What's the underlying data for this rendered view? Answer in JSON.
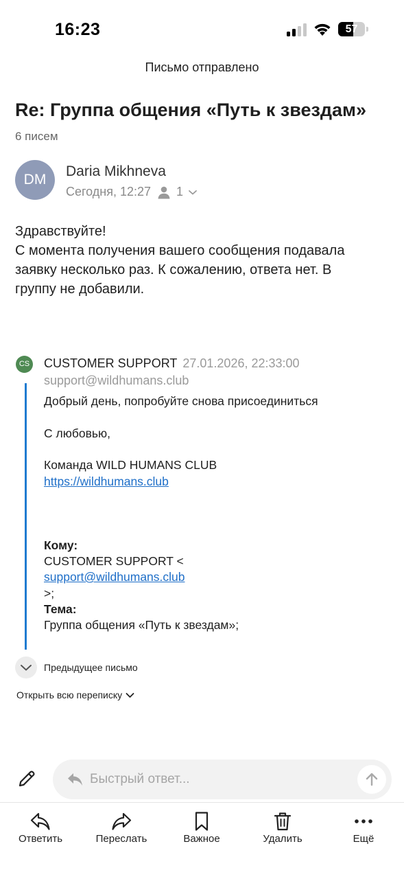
{
  "status_bar": {
    "time": "16:23",
    "battery": "57",
    "battery_level": 0.57
  },
  "notice": "Письмо отправлено",
  "thread": {
    "title": "Re: Группа общения «Путь к звездам»",
    "count": "6 писем"
  },
  "message": {
    "avatar_initials": "DM",
    "sender": "Daria Mikhneva",
    "date": "Сегодня, 12:27",
    "recipients_count": "1",
    "body": [
      "Здравствуйте!",
      "С момента получения вашего сообщения подавала",
      "заявку несколько раз. К сожалению, ответа нет. В",
      "группу не добавили."
    ]
  },
  "quoted": {
    "avatar_initials": "CS",
    "sender": "CUSTOMER SUPPORT",
    "date": "27.01.2026, 22:33:00",
    "email": "support@wildhumans.club",
    "greeting": "Добрый день, попробуйте снова присоединиться",
    "signoff": "С любовью,",
    "team": "Команда WILD HUMANS CLUB",
    "link": "https://wildhumans.club",
    "to_label": "Кому:",
    "to_name": "CUSTOMER SUPPORT <",
    "to_email": "support@wildhumans.club",
    "to_close": ">;",
    "subject_label": "Тема:",
    "subject": "Группа общения «Путь к звездам»;"
  },
  "previous_label": "Предыдущее письмо",
  "open_all_label": "Открыть всю переписку",
  "reply": {
    "placeholder": "Быстрый ответ..."
  },
  "toolbar": {
    "reply": "Ответить",
    "forward": "Переслать",
    "important": "Важное",
    "delete": "Удалить",
    "more": "Ещё"
  },
  "colors": {
    "accent": "#1f7bd0",
    "avatar_dm": "#8f9bb7",
    "avatar_cs": "#4f8a53",
    "link": "#1f6fc8"
  }
}
